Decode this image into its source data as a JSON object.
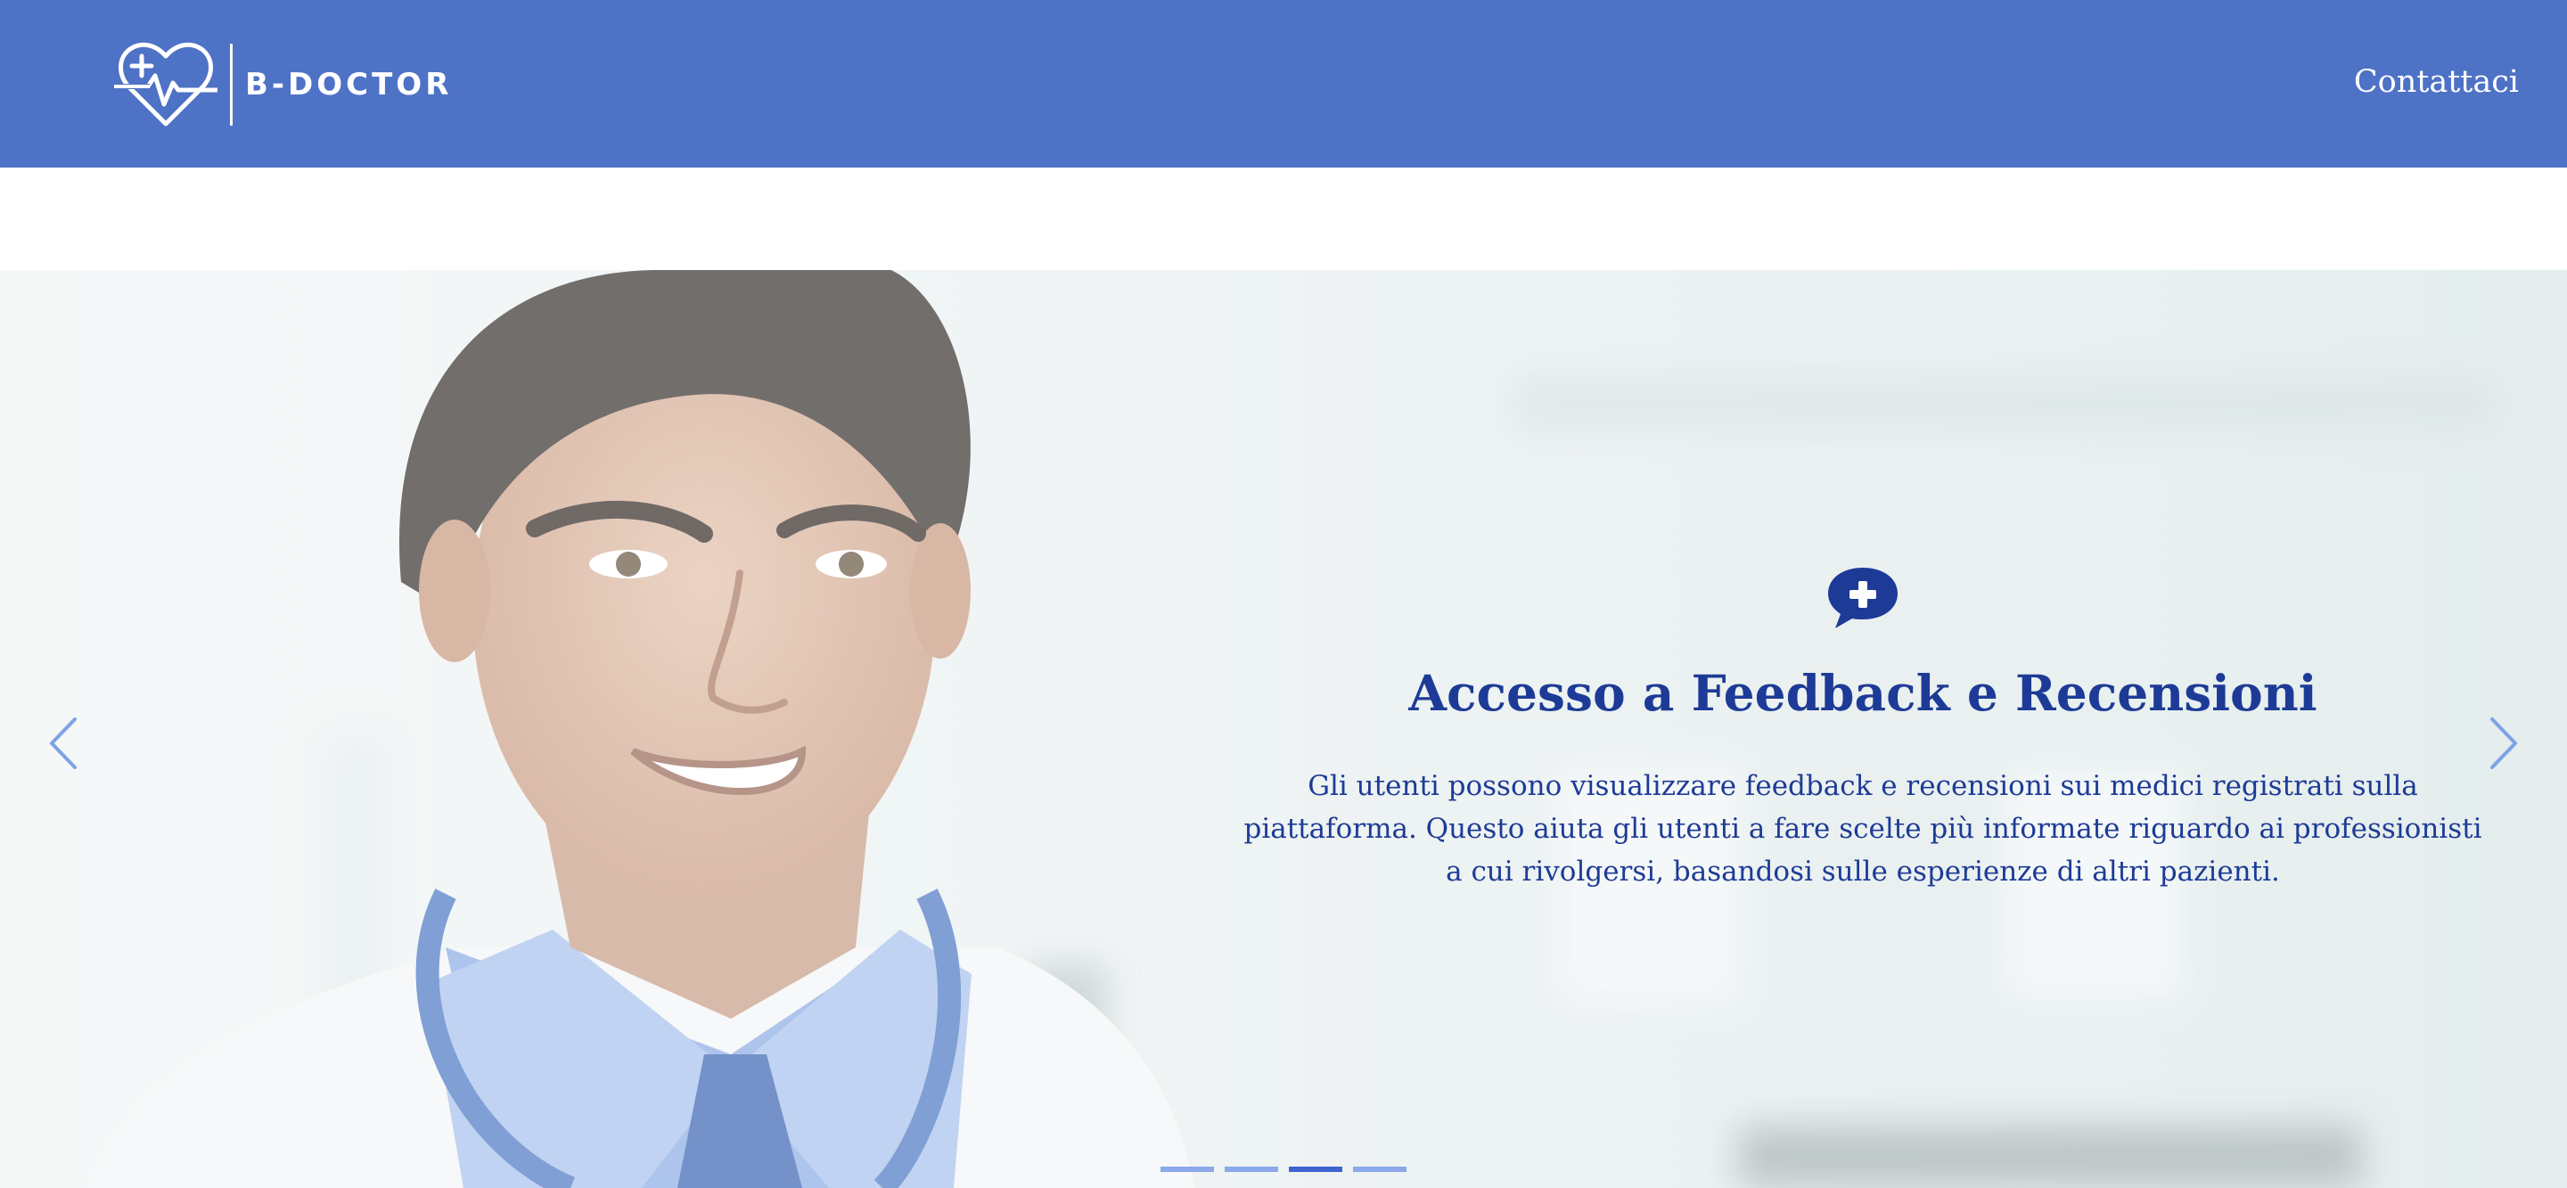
{
  "header": {
    "brand_name": "B-DOCTOR",
    "brand_color": "#4e72c6",
    "contact_link": "Contattaci"
  },
  "carousel": {
    "icon": "chat-bubble-plus-icon",
    "title": "Accesso a Feedback e Recensioni",
    "text": "Gli utenti possono visualizzare feedback e recensioni sui medici registrati sulla piattaforma. Questo aiuta gli utenti a fare scelte più informate riguardo ai professionisti a cui rivolgersi, basandosi sulle esperienze di altri pazienti.",
    "text_color": "#1d3b96",
    "slide_count": 4,
    "active_slide": 3,
    "prev_icon": "chevron-left-icon",
    "next_icon": "chevron-right-icon"
  }
}
